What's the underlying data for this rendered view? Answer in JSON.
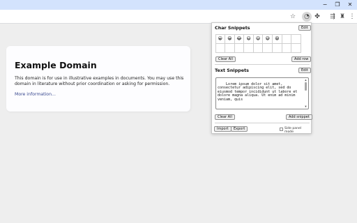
{
  "window": {
    "minimize_glyph": "−",
    "restore_glyph": "❐",
    "close_glyph": "✕"
  },
  "toolbar": {
    "icons": [
      "star-icon",
      "extension-action-icon",
      "puzzle-icon",
      "media-icon",
      "profile-icon",
      "menu-icon"
    ],
    "glyphs": {
      "star": "☆",
      "extension_action": "◔",
      "puzzle": "✤",
      "media": "⇶",
      "profile": "♜",
      "menu": "⋮"
    }
  },
  "page": {
    "title": "Example Domain",
    "description": "This domain is for use in illustrative examples in documents. You may use this domain in literature without prior coordination or asking for permission.",
    "link": "More information..."
  },
  "popup": {
    "char_snippets": {
      "title": "Char Snippets",
      "edit_label": "Edit",
      "cells": [
        "😀",
        "😁",
        "😂",
        "😃",
        "😄",
        "😅",
        "😆",
        "",
        "",
        "",
        "",
        "",
        "",
        "",
        "",
        "",
        "",
        ""
      ],
      "clear_label": "Clear All",
      "add_row_label": "Add row"
    },
    "text_snippets": {
      "title": "Text Snippets",
      "edit_label": "Edit",
      "text": "Lorem ipsum dolor sit amet, consectetur adipiscing elit, sed do eiusmod tempor incididunt ut labore et dolore magna aliqua. Ut enim ad minim veniam, quis",
      "clear_label": "Clear All",
      "add_label": "Add snippet"
    },
    "footer": {
      "import_label": "Import",
      "export_label": "Export",
      "side_panel_label": "Side panel mode",
      "side_panel_checked": false
    }
  }
}
